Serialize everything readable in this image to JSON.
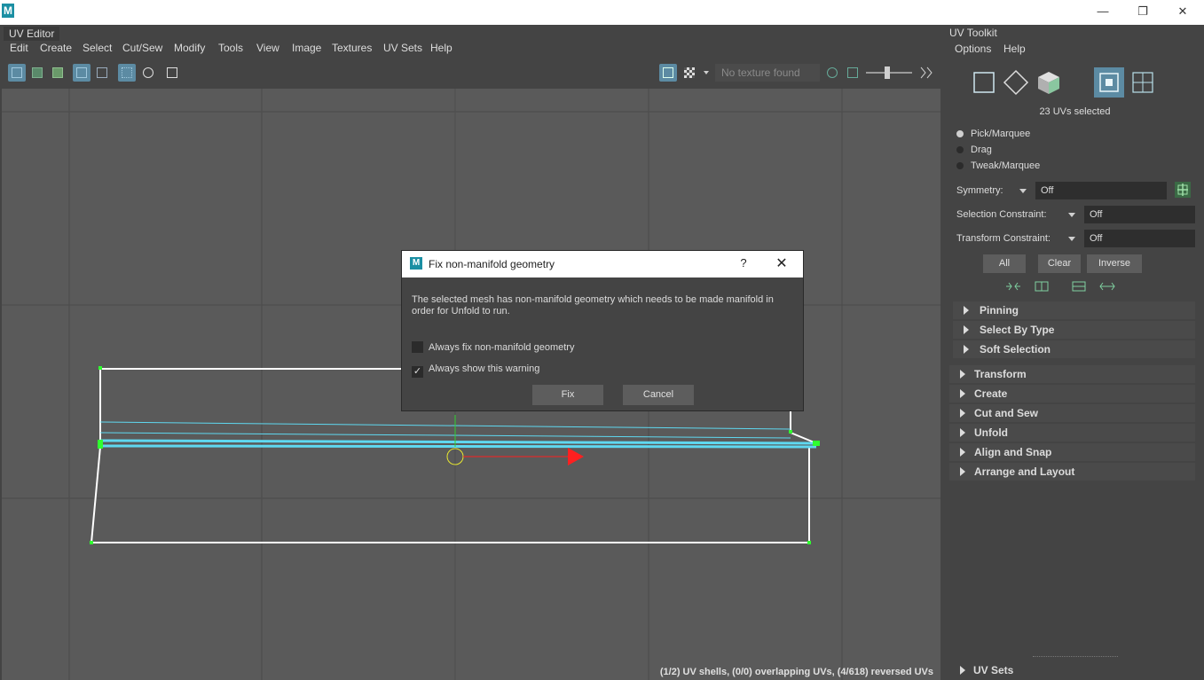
{
  "app": {
    "logo": "M"
  },
  "window_controls": {
    "minimize": "—",
    "restore": "❐",
    "close": "✕"
  },
  "editor": {
    "panel_tab": "UV Editor",
    "menu": [
      "Edit",
      "Create",
      "Select",
      "Cut/Sew",
      "Modify",
      "Tools",
      "View",
      "Image",
      "Textures",
      "UV Sets",
      "Help"
    ],
    "texture_placeholder": "No texture found",
    "status": "(1/2) UV shells, (0/0) overlapping UVs, (4/618) reversed UVs"
  },
  "toolkit": {
    "tab": "UV Toolkit",
    "menu": [
      "Options",
      "Help"
    ],
    "uv_count": "23 UVs selected",
    "modes": [
      {
        "label": "Pick/Marquee",
        "selected": true
      },
      {
        "label": "Drag",
        "selected": false
      },
      {
        "label": "Tweak/Marquee",
        "selected": false
      }
    ],
    "symmetry": {
      "label": "Symmetry:",
      "value": "Off"
    },
    "selection_constraint": {
      "label": "Selection Constraint:",
      "value": "Off"
    },
    "transform_constraint": {
      "label": "Transform Constraint:",
      "value": "Off"
    },
    "buttons": {
      "all": "All",
      "clear": "Clear",
      "inverse": "Inverse"
    },
    "sub_sections": [
      "Pinning",
      "Select By Type",
      "Soft Selection"
    ],
    "sections": [
      "Transform",
      "Create",
      "Cut and Sew",
      "Unfold",
      "Align and Snap",
      "Arrange and Layout"
    ],
    "footer_section": "UV Sets"
  },
  "dialog": {
    "logo": "M",
    "title": "Fix non-manifold geometry",
    "help": "?",
    "close": "✕",
    "message": "The selected mesh has non-manifold geometry which needs to be made manifold in order for Unfold to run.",
    "always_fix": {
      "label": "Always fix non-manifold geometry",
      "checked": false,
      "mark": ""
    },
    "always_show": {
      "label": "Always show this warning",
      "checked": true,
      "mark": "✓"
    },
    "fix_label": "Fix",
    "cancel_label": "Cancel"
  },
  "colors": {
    "accent": "#5c8ba3",
    "uv_edge": "#ffffff",
    "uv_selected": "#5fd8f0",
    "uv_vertex": "#30ff30",
    "manip_x": "#ff2020",
    "manip_y": "#30d030",
    "manip_center": "#e8e830"
  }
}
